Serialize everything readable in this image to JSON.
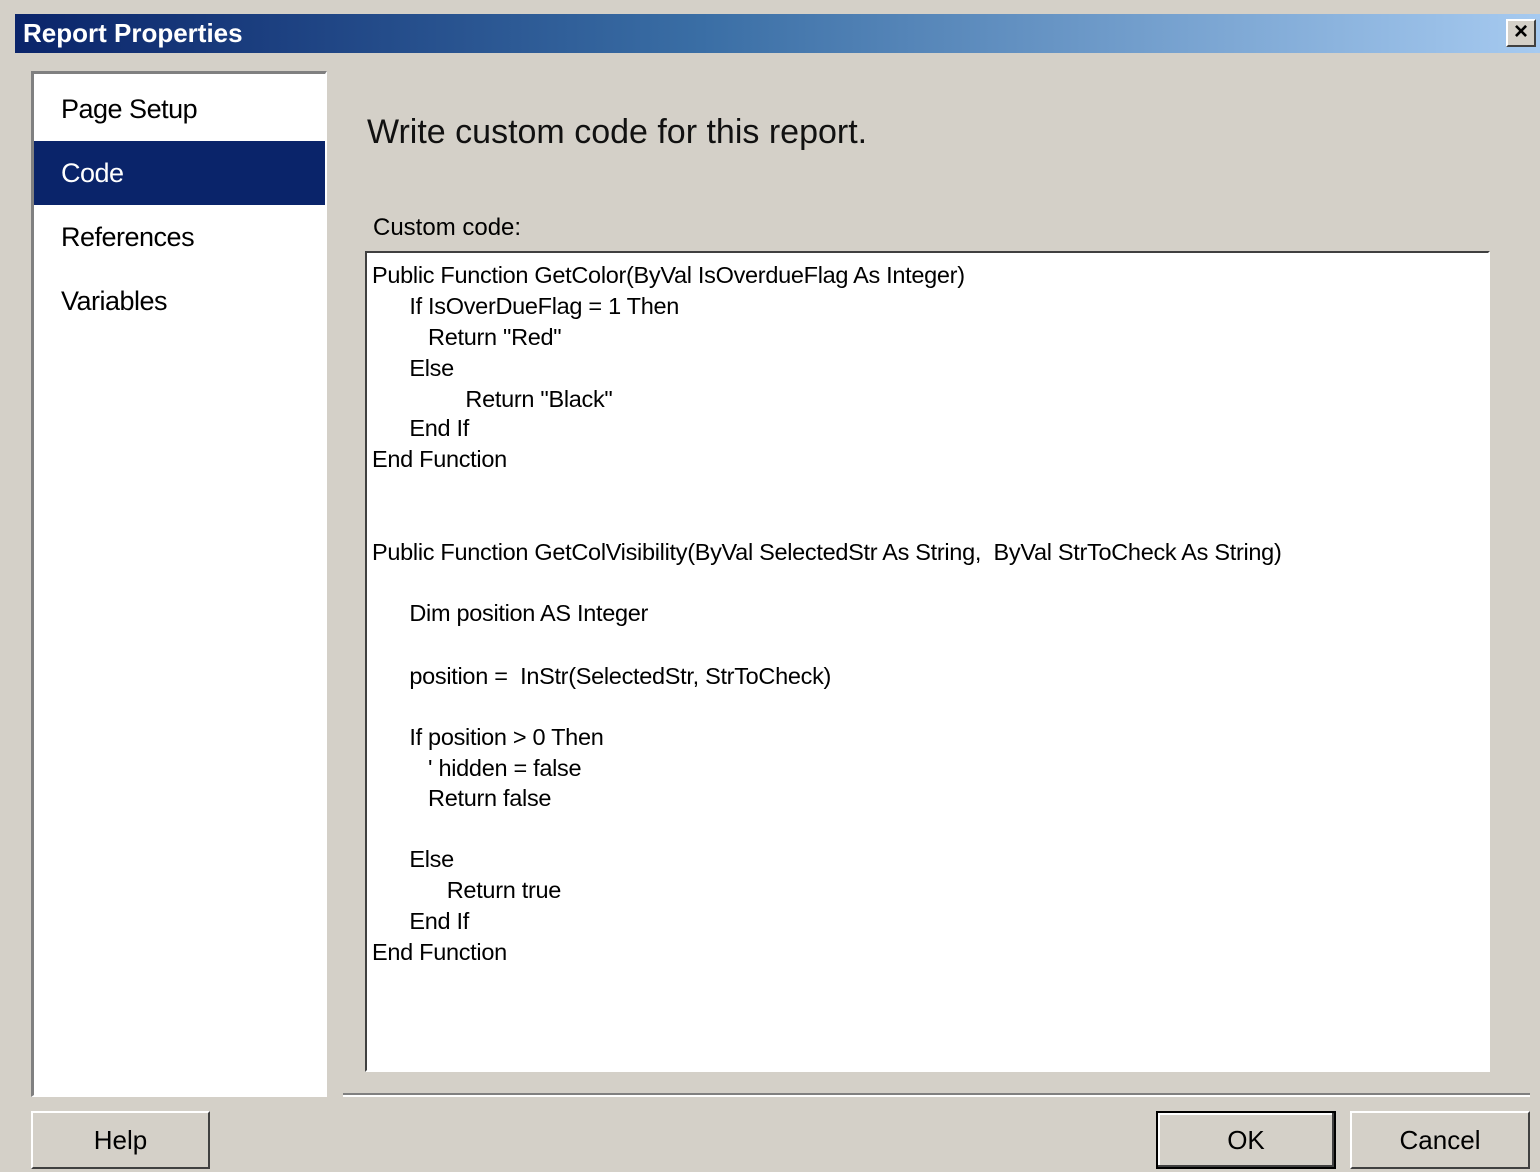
{
  "window": {
    "title": "Report Properties",
    "close_label": "✕"
  },
  "nav": {
    "items": [
      {
        "label": "Page Setup",
        "selected": false
      },
      {
        "label": "Code",
        "selected": true
      },
      {
        "label": "References",
        "selected": false
      },
      {
        "label": "Variables",
        "selected": false
      }
    ]
  },
  "main": {
    "heading": "Write custom code for this report.",
    "code_label": "Custom code:",
    "code_lines": [
      "Public Function GetColor(ByVal IsOverdueFlag As Integer)",
      "      If IsOverDueFlag = 1 Then",
      "         Return \"Red\"",
      "      Else",
      "               Return \"Black\"",
      "      End If",
      "End Function",
      "Public Function GetColVisibility(ByVal SelectedStr As String,  ByVal StrToCheck As String)",
      "      Dim position AS Integer",
      "      position =  InStr(SelectedStr, StrToCheck)",
      "      If position > 0 Then",
      "         ' hidden = false",
      "         Return false",
      "      Else",
      "            Return true",
      "      End If",
      "End Function"
    ]
  },
  "buttons": {
    "help": "Help",
    "ok": "OK",
    "cancel": "Cancel"
  },
  "colors": {
    "selection": "#0a246a",
    "dialog_bg": "#d4d0c8",
    "titlebar_start": "#0a246a",
    "titlebar_end": "#a6caf0"
  }
}
